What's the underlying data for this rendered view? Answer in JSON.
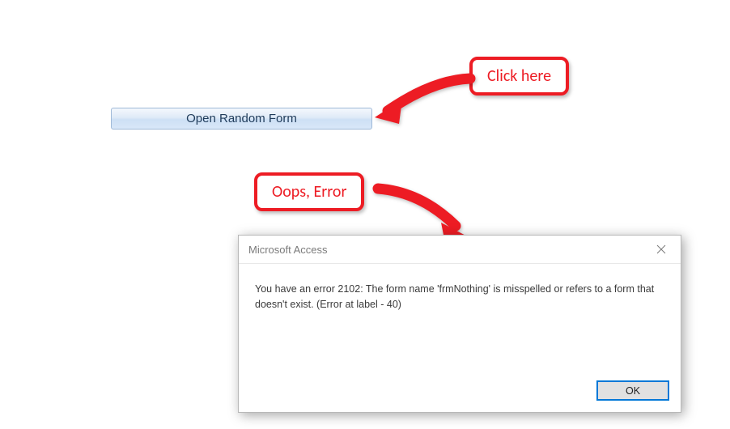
{
  "button": {
    "label": "Open Random Form"
  },
  "annotations": {
    "click_here": "Click here",
    "oops_error": "Oops, Error"
  },
  "dialog": {
    "title": "Microsoft Access",
    "message": "You have an error 2102: The form name 'frmNothing' is misspelled or refers to a form that doesn't exist. (Error at label - 40)",
    "ok_label": "OK"
  }
}
